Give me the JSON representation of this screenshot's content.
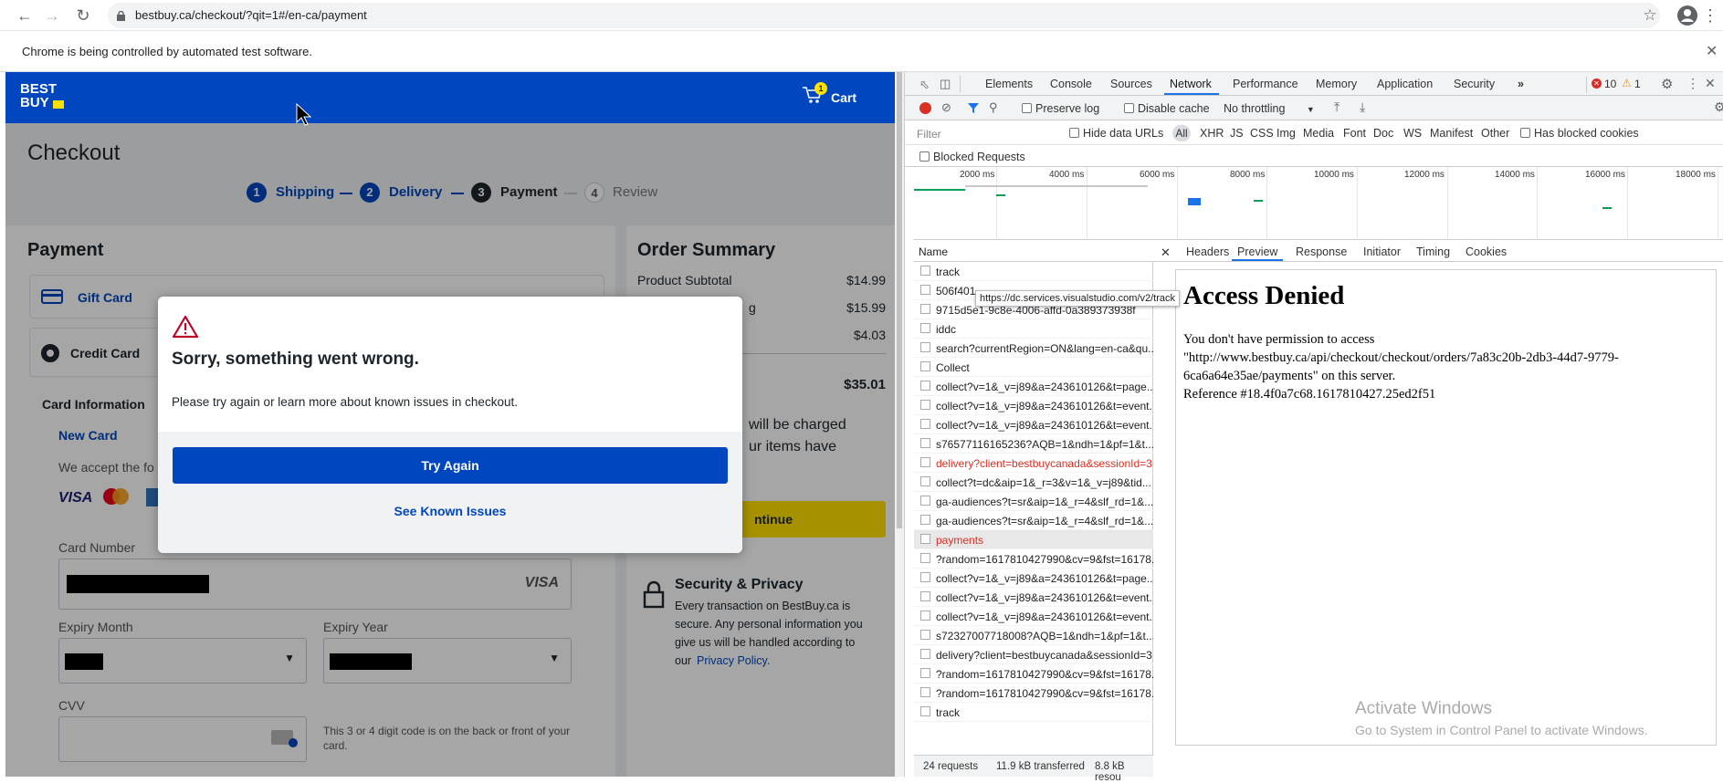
{
  "browser": {
    "url": "bestbuy.ca/checkout/?qit=1#/en-ca/payment",
    "infobar": "Chrome is being controlled by automated test software."
  },
  "header": {
    "logo": "BEST BUY",
    "cart_label": "Cart",
    "cart_count": "1"
  },
  "checkout": {
    "title": "Checkout",
    "steps": [
      {
        "num": "1",
        "label": "Shipping"
      },
      {
        "num": "2",
        "label": "Delivery"
      },
      {
        "num": "3",
        "label": "Payment"
      },
      {
        "num": "4",
        "label": "Review"
      }
    ],
    "payment_title": "Payment",
    "gift_card": "Gift Card",
    "credit_card": "Credit Card",
    "card_info": "Card Information",
    "new_card": "New Card",
    "accept": "We accept the fo",
    "card_number_label": "Card Number",
    "card_brand": "VISA",
    "expiry_month": "Expiry Month",
    "expiry_year": "Expiry Year",
    "cvv": "CVV",
    "cvv_help": "This 3 or 4 digit code is on the back or front of your card."
  },
  "summary": {
    "title": "Order Summary",
    "product_subtotal_label": "Product Subtotal",
    "product_subtotal": "$14.99",
    "shipping_partial": "g",
    "shipping": "$15.99",
    "tax": "$4.03",
    "total": "$35.01",
    "charge_note_1": "will be charged",
    "charge_note_2": "ur items have",
    "continue": "ntinue",
    "security_title": "Security & Privacy",
    "security_text_1": "Every transaction on BestBuy.ca is",
    "security_text_2": "secure. Any personal information you",
    "security_text_3": "give us will be handled according to",
    "security_text_4": "our",
    "privacy_link": "Privacy Policy."
  },
  "modal": {
    "title": "Sorry, something went wrong.",
    "message": "Please try again or learn more about known issues in checkout.",
    "try_again": "Try Again",
    "see_known": "See Known Issues"
  },
  "devtools": {
    "tabs": [
      "Elements",
      "Console",
      "Sources",
      "Network",
      "Performance",
      "Memory",
      "Application",
      "Security"
    ],
    "error_count": "10",
    "warn_count": "1",
    "preserve_log": "Preserve log",
    "disable_cache": "Disable cache",
    "throttling": "No throttling",
    "filter_placeholder": "Filter",
    "hide_data_urls": "Hide data URLs",
    "types": [
      "All",
      "XHR",
      "JS",
      "CSS",
      "Img",
      "Media",
      "Font",
      "Doc",
      "WS",
      "Manifest",
      "Other"
    ],
    "has_blocked": "Has blocked cookies",
    "blocked_requests": "Blocked Requests",
    "ticks": [
      "2000 ms",
      "4000 ms",
      "6000 ms",
      "8000 ms",
      "10000 ms",
      "12000 ms",
      "14000 ms",
      "16000 ms",
      "18000 ms"
    ],
    "name_col": "Name",
    "requests": [
      "track",
      "506f401",
      "9715d5e1-9c8e-4006-affd-0a389373938f",
      "iddc",
      "search?currentRegion=ON&lang=en-ca&qu...",
      "Collect",
      "collect?v=1&_v=j89&a=243610126&t=page...",
      "collect?v=1&_v=j89&a=243610126&t=event...",
      "collect?v=1&_v=j89&a=243610126&t=event...",
      "s76577116165236?AQB=1&ndh=1&pf=1&t...",
      "delivery?client=bestbuycanada&sessionId=3...",
      "collect?t=dc&aip=1&_r=3&v=1&_v=j89&tid...",
      "ga-audiences?t=sr&aip=1&_r=4&slf_rd=1&...",
      "ga-audiences?t=sr&aip=1&_r=4&slf_rd=1&...",
      "payments",
      "?random=1617810427990&cv=9&fst=16178...",
      "collect?v=1&_v=j89&a=243610126&t=page...",
      "collect?v=1&_v=j89&a=243610126&t=event...",
      "collect?v=1&_v=j89&a=243610126&t=event...",
      "s72327007718008?AQB=1&ndh=1&pf=1&t...",
      "delivery?client=bestbuycanada&sessionId=3...",
      "?random=1617810427990&cv=9&fst=16178...",
      "?random=1617810427990&cv=9&fst=16178...",
      "track"
    ],
    "tooltip": "https://dc.services.visualstudio.com/v2/track",
    "status_requests": "24 requests",
    "status_transferred": "11.9 kB transferred",
    "status_resources": "8.8 kB resou",
    "detail_tabs": [
      "Headers",
      "Preview",
      "Response",
      "Initiator",
      "Timing",
      "Cookies"
    ],
    "preview_title": "Access Denied",
    "preview_text": "You don't have permission to access \"http://www.bestbuy.ca/api/checkout/checkout/orders/7a83c20b-2db3-44d7-9779-6ca6a64e35ae/payments\" on this server.",
    "preview_ref": "Reference #18.4f0a7c68.1617810427.25ed2f51"
  },
  "watermark": {
    "line1": "Activate Windows",
    "line2": "Go to System in Control Panel to activate Windows."
  }
}
